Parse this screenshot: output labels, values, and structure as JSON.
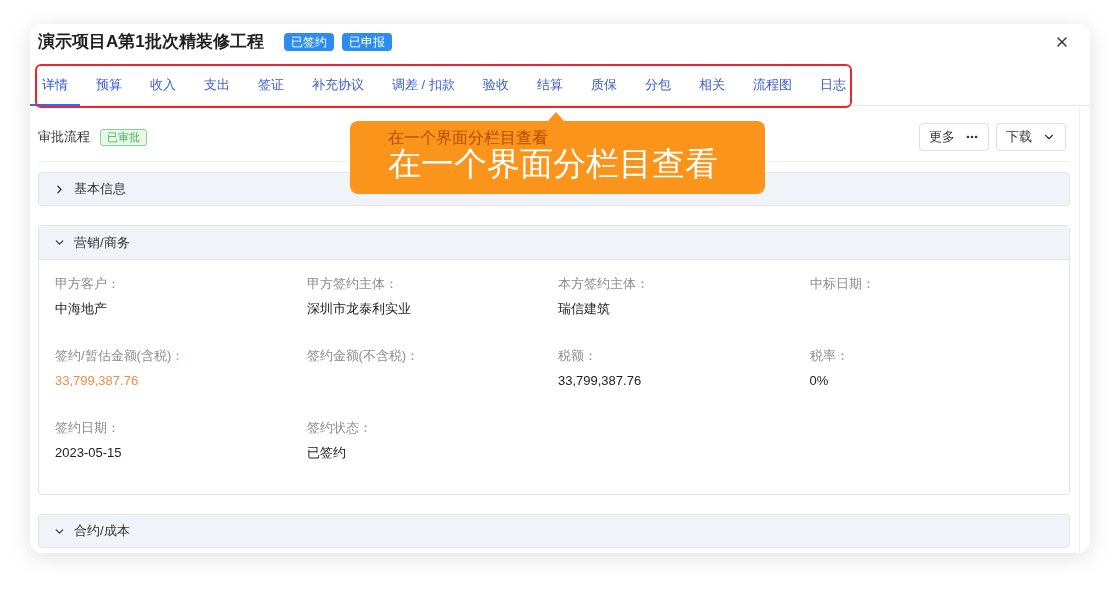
{
  "window": {
    "title": "演示项目A第1批次精装修工程",
    "badges": [
      "已签约",
      "已申报"
    ]
  },
  "tabs": [
    {
      "label": "详情",
      "selected": true
    },
    {
      "label": "预算",
      "selected": false
    },
    {
      "label": "收入",
      "selected": false
    },
    {
      "label": "支出",
      "selected": false
    },
    {
      "label": "签证",
      "selected": false
    },
    {
      "label": "补充协议",
      "selected": false
    },
    {
      "label": "调差 / 扣款",
      "selected": false
    },
    {
      "label": "验收",
      "selected": false
    },
    {
      "label": "结算",
      "selected": false
    },
    {
      "label": "质保",
      "selected": false
    },
    {
      "label": "分包",
      "selected": false
    },
    {
      "label": "相关",
      "selected": false
    },
    {
      "label": "流程图",
      "selected": false
    },
    {
      "label": "日志",
      "selected": false
    }
  ],
  "annotation": {
    "ghost_text": "在一个界面分栏目查看",
    "callout_text": "在一个界面分栏目查看"
  },
  "approval": {
    "label": "审批流程",
    "status": "已审批"
  },
  "actions": [
    {
      "label": "更多",
      "kind": "more"
    },
    {
      "label": "下载",
      "kind": "dropdown"
    }
  ],
  "sections": [
    {
      "title": "基本信息",
      "expanded": false
    },
    {
      "title": "营销/商务",
      "expanded": true,
      "fields": [
        {
          "label": "甲方客户：",
          "value": "中海地产",
          "highlight": false
        },
        {
          "label": "甲方签约主体：",
          "value": "深圳市龙泰利实业",
          "highlight": false
        },
        {
          "label": "本方签约主体：",
          "value": "瑞信建筑",
          "highlight": false
        },
        {
          "label": "中标日期：",
          "highlight": false
        },
        {
          "label": "签约/暂估金额(含税)：",
          "value": "33,799,387.76",
          "highlight": true
        },
        {
          "label": "签约金额(不含税)：",
          "highlight": false
        },
        {
          "label": "税额：",
          "value": "33,799,387.76",
          "highlight": false
        },
        {
          "label": "税率：",
          "value": "0%",
          "highlight": false
        },
        {
          "label": "签约日期：",
          "value": "2023-05-15",
          "highlight": false
        },
        {
          "label": "签约状态：",
          "value": "已签约",
          "highlight": false
        }
      ]
    },
    {
      "title": "合约/成本",
      "expanded": true
    }
  ]
}
